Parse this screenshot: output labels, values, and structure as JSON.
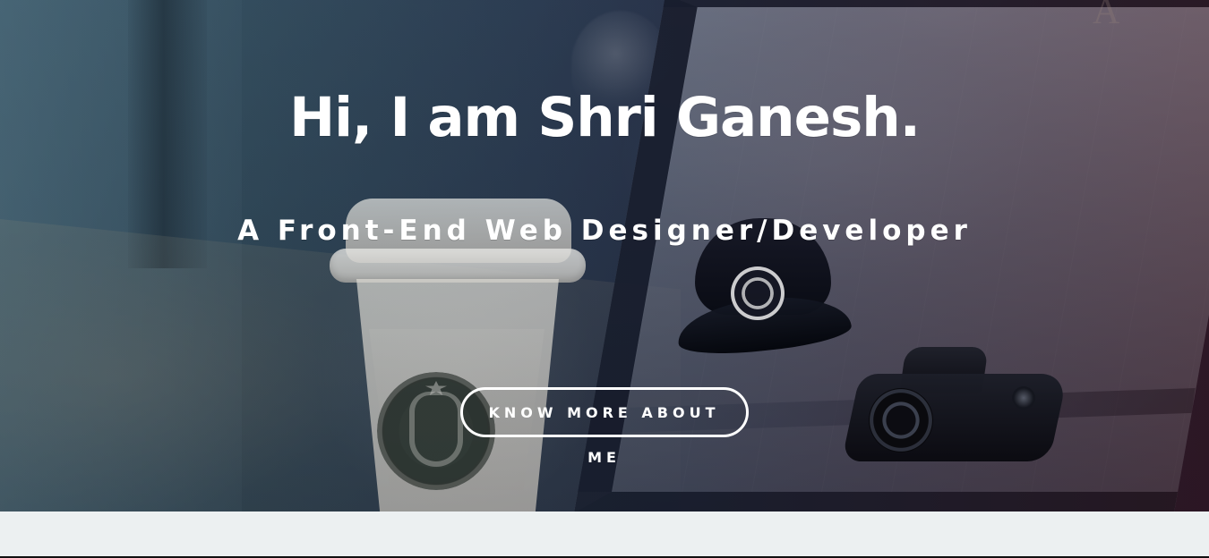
{
  "hero": {
    "headline": "Hi, I am Shri Ganesh.",
    "subheadline": "A Front-End Web Designer/Developer",
    "cta_label": "KNOW MORE ABOUT ME"
  },
  "icons": [
    "coffee-cup-icon",
    "cap-icon",
    "camera-icon",
    "logo-mark-icon"
  ],
  "colors": {
    "hero_overlay_left": "#1d3a48",
    "hero_overlay_right": "#371c24",
    "text_primary": "#ffffff",
    "page_background": "#ecf0f1"
  }
}
